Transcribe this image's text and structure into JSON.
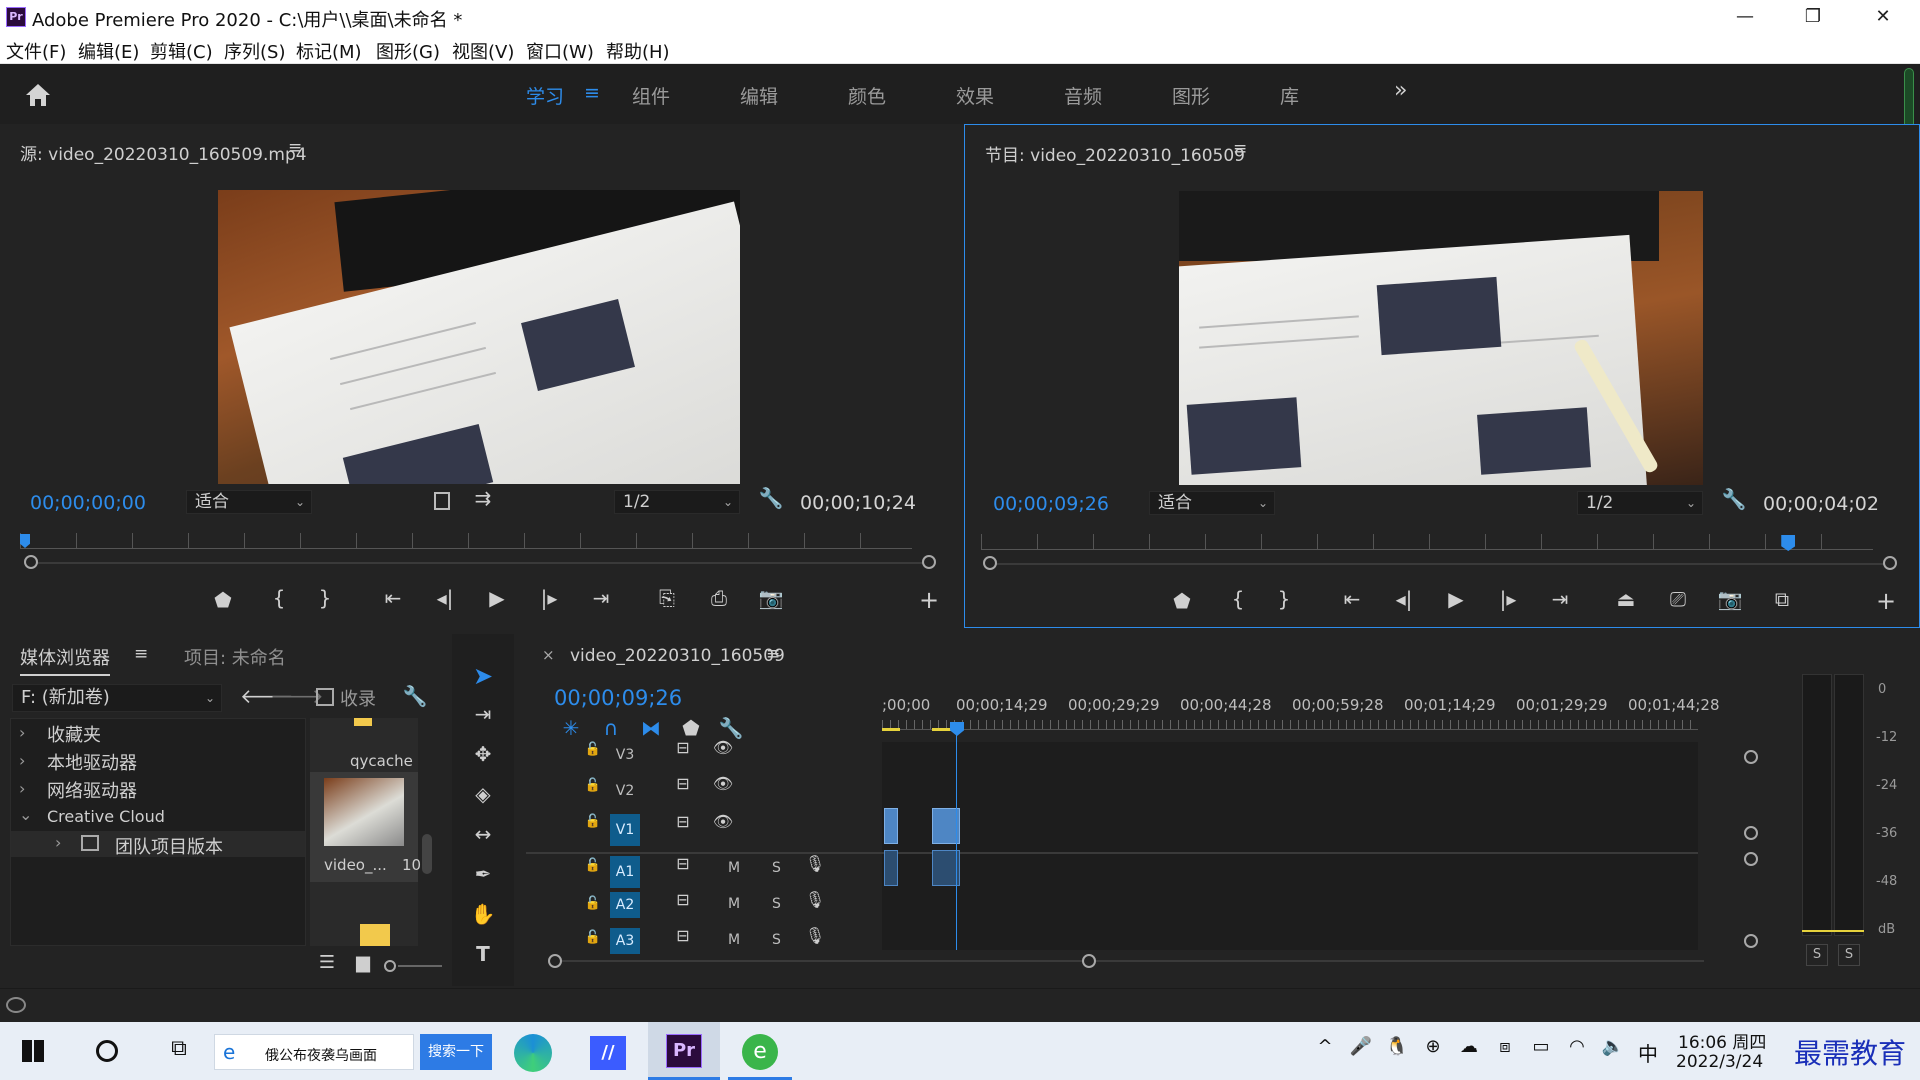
{
  "window": {
    "title": "Adobe Premiere Pro 2020 - C:\\用户\\\\桌面\\未命名 *",
    "logo": "Pr",
    "minimize": "—",
    "restore": "❐",
    "close": "✕"
  },
  "menu": [
    "文件(F)",
    "编辑(E)",
    "剪辑(C)",
    "序列(S)",
    "标记(M)",
    "图形(G)",
    "视图(V)",
    "窗口(W)",
    "帮助(H)"
  ],
  "workspaces": {
    "home_icon": "home-icon",
    "tabs": [
      {
        "label": "学习",
        "active": true
      },
      {
        "label": "组件"
      },
      {
        "label": "编辑"
      },
      {
        "label": "颜色"
      },
      {
        "label": "效果"
      },
      {
        "label": "音频"
      },
      {
        "label": "图形"
      },
      {
        "label": "库"
      }
    ],
    "menu_glyph": "≡",
    "more": "»"
  },
  "source_monitor": {
    "title": "源: video_20220310_160509.mp4",
    "timecode": "00;00;00;00",
    "fit": "适合",
    "resolution": "1/2",
    "duration": "00;00;10;24",
    "playhead_fraction": 0.0
  },
  "program_monitor": {
    "title": "节目: video_20220310_160509",
    "timecode": "00;00;09;26",
    "fit": "适合",
    "resolution": "1/2",
    "duration": "00;00;04;02",
    "playhead_fraction": 0.905
  },
  "media_browser": {
    "tab": "媒体浏览器",
    "project_tab": "项目: 未命名",
    "drive": "F: (新加卷)",
    "collect": "收录",
    "tree": [
      {
        "label": "收藏夹",
        "caret": "›"
      },
      {
        "label": "本地驱动器",
        "caret": "›"
      },
      {
        "label": "网络驱动器",
        "caret": "›"
      },
      {
        "label": "Creative Cloud",
        "caret": "⌄"
      },
      {
        "label": "团队项目版本",
        "caret": "›"
      }
    ],
    "items": [
      {
        "name": "qycache"
      },
      {
        "name": "video_...",
        "extra": "10"
      }
    ]
  },
  "timeline": {
    "sequence": "video_20220310_160509",
    "close": "×",
    "timecode": "00;00;09;26",
    "ruler": [
      ";00;00",
      "00;00;14;29",
      "00;00;29;29",
      "00;00;44;28",
      "00;00;59;28",
      "00;01;14;29",
      "00;01;29;29",
      "00;01;44;28"
    ],
    "video_tracks": [
      "V3",
      "V2",
      "V1"
    ],
    "audio_tracks": [
      "A1",
      "A2",
      "A3"
    ],
    "m": "M",
    "s": "S"
  },
  "meter": {
    "scale": [
      "0",
      "-12",
      "-24",
      "-36",
      "-48",
      "dB"
    ],
    "solo_l": "S",
    "solo_r": "S"
  },
  "taskbar": {
    "search_text": "俄公布夜袭乌画面",
    "search_button": "搜索一下",
    "ime": "中",
    "time": "16:06 周四",
    "date": "2022/3/24",
    "watermark": "最需教育"
  },
  "colors": {
    "accent": "#2d8ceb",
    "panel": "#232323",
    "track_on": "#0f5c8c",
    "clip": "#4e86c4"
  }
}
